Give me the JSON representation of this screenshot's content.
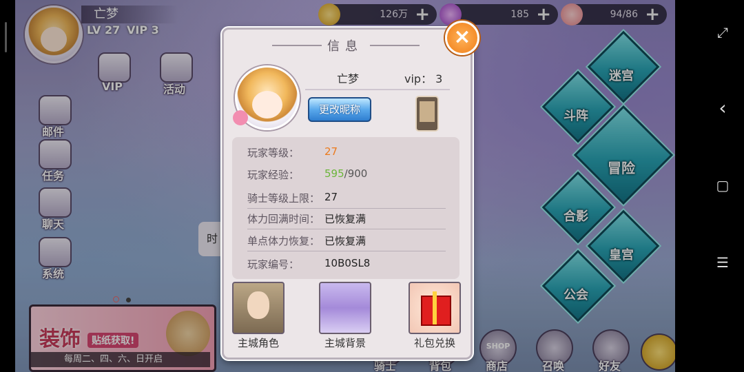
{
  "player": {
    "name": "亡梦",
    "level_text": "LV 27",
    "vip_text": "VIP 3"
  },
  "resources": [
    {
      "name": "gold",
      "value": "126万",
      "icon": "coin-icon",
      "color": "#f2c14e"
    },
    {
      "name": "gems",
      "value": "185",
      "icon": "gem-icon",
      "color": "#c472e6"
    },
    {
      "name": "stamina",
      "value": "94/86",
      "icon": "peach-icon",
      "color": "#f29a9a"
    }
  ],
  "left_menu": [
    {
      "label": "VIP",
      "icon": "crown-icon"
    },
    {
      "label": "活动",
      "icon": "gift-box-icon"
    },
    {
      "label": "邮件",
      "icon": "mail-icon"
    },
    {
      "label": "任务",
      "icon": "quill-icon"
    },
    {
      "label": "聊天",
      "icon": "teacup-icon"
    },
    {
      "label": "系统",
      "icon": "gear-icon"
    }
  ],
  "right_menu": [
    {
      "label": "迷宫"
    },
    {
      "label": "斗阵"
    },
    {
      "label": "冒险"
    },
    {
      "label": "合影"
    },
    {
      "label": "皇宫"
    },
    {
      "label": "公会"
    }
  ],
  "bottom_bar": [
    {
      "label": "骑士"
    },
    {
      "label": "背包"
    },
    {
      "label": "商店",
      "badge": "SHOP"
    },
    {
      "label": "召唤"
    },
    {
      "label": "好友"
    }
  ],
  "banner": {
    "title": "装饰",
    "subtitle": "贴纸获取!",
    "note": "每周二、四、六、日开启"
  },
  "side_tab_text": "时",
  "dialog": {
    "title": "信息",
    "close_label": "×",
    "name": "亡梦",
    "vip_label": "vip： 3",
    "rename_label": "更改昵称",
    "info": [
      {
        "key": "玩家等级：",
        "value": "27"
      },
      {
        "key": "玩家经验：",
        "value_current": "595",
        "value_max": "/900"
      },
      {
        "key": "骑士等级上限：",
        "value": "27"
      },
      {
        "key": "体力回满时间：",
        "value": "已恢复满"
      },
      {
        "key": "单点体力恢复：",
        "value": "已恢复满"
      },
      {
        "key": "玩家编号：",
        "value": "10B0SL8"
      }
    ],
    "options": [
      {
        "label": "主城角色"
      },
      {
        "label": "主城背景"
      },
      {
        "label": "礼包兑换"
      }
    ]
  },
  "system_nav": {
    "expand": "⤢",
    "back": "‹",
    "home": "▢",
    "menu": "☰"
  }
}
